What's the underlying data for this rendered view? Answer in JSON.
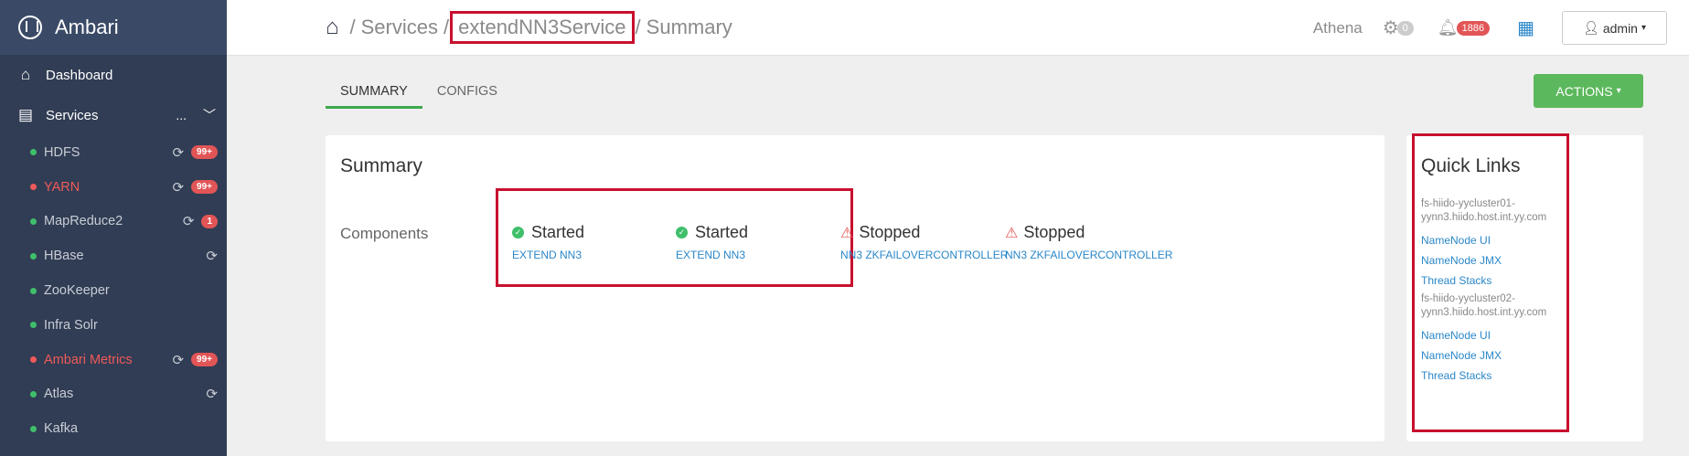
{
  "brand": {
    "title": "Ambari"
  },
  "sidebar": {
    "dashboard": "Dashboard",
    "services": "Services",
    "services_more": "...",
    "items": [
      {
        "label": "HDFS",
        "alert": false,
        "refresh": true,
        "badge": "99+"
      },
      {
        "label": "YARN",
        "alert": true,
        "refresh": true,
        "badge": "99+"
      },
      {
        "label": "MapReduce2",
        "alert": false,
        "refresh": true,
        "badge": "1"
      },
      {
        "label": "HBase",
        "alert": false,
        "refresh": true,
        "badge": ""
      },
      {
        "label": "ZooKeeper",
        "alert": false,
        "refresh": false,
        "badge": ""
      },
      {
        "label": "Infra Solr",
        "alert": false,
        "refresh": false,
        "badge": ""
      },
      {
        "label": "Ambari Metrics",
        "alert": true,
        "refresh": true,
        "badge": "99+"
      },
      {
        "label": "Atlas",
        "alert": false,
        "refresh": true,
        "badge": ""
      },
      {
        "label": "Kafka",
        "alert": false,
        "refresh": false,
        "badge": ""
      }
    ]
  },
  "breadcrumb": {
    "sep": "/",
    "services": "Services",
    "service": "extendNN3Service",
    "page": "Summary"
  },
  "topbar": {
    "cluster": "Athena",
    "ops_count": "0",
    "alerts_count": "1886",
    "user": "admin"
  },
  "tabs": {
    "summary": "SUMMARY",
    "configs": "CONFIGS"
  },
  "actions_label": "ACTIONS",
  "summary": {
    "title": "Summary",
    "components_label": "Components",
    "components": [
      {
        "status": "Started",
        "name": "EXTEND NN3",
        "ok": true
      },
      {
        "status": "Started",
        "name": "EXTEND NN3",
        "ok": true
      },
      {
        "status": "Stopped",
        "name": "NN3 ZKFAILOVERCONTROLLER",
        "ok": false
      },
      {
        "status": "Stopped",
        "name": "NN3 ZKFAILOVERCONTROLLER",
        "ok": false
      }
    ]
  },
  "quick_links": {
    "title": "Quick Links",
    "hosts": [
      {
        "host": "fs-hiido-yycluster01-yynn3.hiido.host.int.yy.com",
        "links": [
          "NameNode UI",
          "NameNode JMX",
          "Thread Stacks"
        ]
      },
      {
        "host": "fs-hiido-yycluster02-yynn3.hiido.host.int.yy.com",
        "links": [
          "NameNode UI",
          "NameNode JMX",
          "Thread Stacks"
        ]
      }
    ]
  },
  "colors": {
    "sidebar": "#313d54",
    "accent_green": "#5cb85c",
    "alert_red": "#e25556",
    "link_blue": "#2a87c9",
    "highlight": "#c8102e"
  }
}
